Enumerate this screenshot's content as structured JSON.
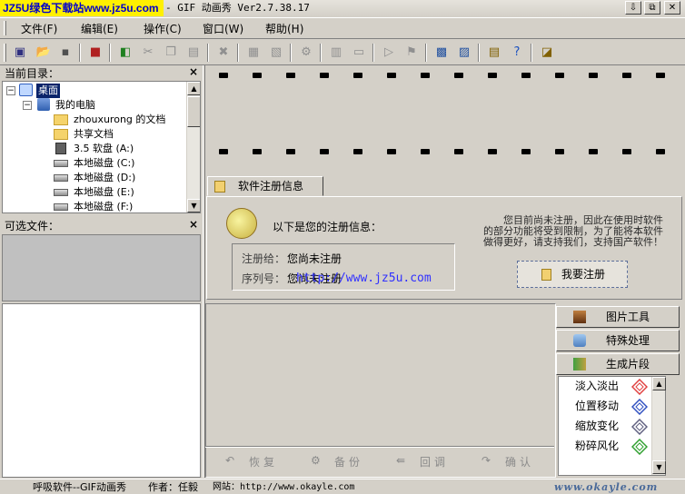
{
  "window": {
    "watermark": "JZ5U绿色下载站www.jz5u.com",
    "title": "- GIF 动画秀 Ver2.7.38.17",
    "controls": [
      "⇩",
      "⧉",
      "✕"
    ]
  },
  "menu": [
    "文件(F)",
    "编辑(E)",
    "操作(C)",
    "窗口(W)",
    "帮助(H)"
  ],
  "dir_panel": {
    "title": "当前目录：",
    "close": "×",
    "tree": [
      {
        "label": "桌面",
        "icon": "desktop-icon",
        "indent": 0,
        "selected": true,
        "expander": "−"
      },
      {
        "label": "我的电脑",
        "icon": "computer-icon",
        "indent": 1,
        "expander": "−"
      },
      {
        "label": "zhouxurong 的文档",
        "icon": "folder-icon",
        "indent": 2
      },
      {
        "label": "共享文档",
        "icon": "folder-icon",
        "indent": 2
      },
      {
        "label": "3.5 软盘 (A:)",
        "icon": "floppy-icon",
        "indent": 2
      },
      {
        "label": "本地磁盘 (C:)",
        "icon": "drive-icon",
        "indent": 2
      },
      {
        "label": "本地磁盘 (D:)",
        "icon": "drive-icon",
        "indent": 2
      },
      {
        "label": "本地磁盘 (E:)",
        "icon": "drive-icon",
        "indent": 2
      },
      {
        "label": "本地磁盘 (F:)",
        "icon": "drive-icon",
        "indent": 2
      }
    ]
  },
  "files_panel": {
    "title": "可选文件：",
    "close": "×"
  },
  "reg": {
    "tab": "软件注册信息",
    "heading": "以下是您的注册信息：",
    "to_label": "注册给：",
    "to_value": "您尚未注册",
    "serial_label": "序列号：",
    "serial_value": "您尚未注册",
    "url_overlay": "http://www.jz5u.com",
    "notice": [
      "您目前尚未注册，因此在使用时软件",
      "的部分功能将受到限制，为了能将本软件",
      "做得更好，请支持我们，支持国产软件！"
    ],
    "button": "我要注册"
  },
  "lower_buttons": [
    "恢复",
    "备份",
    "回调",
    "确认"
  ],
  "side": {
    "buttons": [
      "图片工具",
      "特殊处理",
      "生成片段"
    ],
    "effects": [
      "淡入淡出",
      "位置移动",
      "缩放变化",
      "粉碎风化"
    ]
  },
  "status": {
    "left": "呼吸软件--GIF动画秀",
    "author": "作者：任毅",
    "site": "网站：http://www.okayle.com",
    "logo": "www.okayle.com"
  },
  "colors": {
    "face": "#d4d0c8",
    "selection": "#0a246a",
    "watermark_bg": "#fff000",
    "watermark_fg": "#0000cc",
    "url_overlay": "#3030ff"
  }
}
